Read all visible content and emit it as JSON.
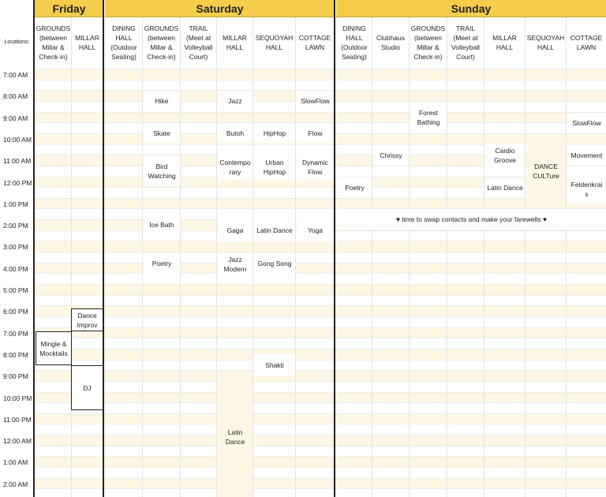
{
  "days": {
    "friday": "Friday",
    "saturday": "Saturday",
    "sunday": "Sunday"
  },
  "locations_label": "Locations:",
  "columns": {
    "fri_grounds": "GROUNDS (between Millar & Check-in)",
    "fri_millar": "MILLAR HALL",
    "sat_dining": "DINING HALL (Outdoor Seating)",
    "sat_grounds": "GROUNDS (between Millar & Check-in)",
    "sat_trail": "TRAIL (Meet at Volleyball Court)",
    "sat_millar": "MILLAR HALL",
    "sat_sequoyah": "SEQUOYAH HALL",
    "sat_cottage": "COTTAGE LAWN",
    "sun_dining": "DINING HALL (Outdoor Seating)",
    "sun_clubhaus": "Clubhaus Studio",
    "sun_grounds": "GROUNDS (between Millar & Check-in)",
    "sun_trail": "TRAIL (Meet at Volleyball Court)",
    "sun_millar": "MILLAR HALL",
    "sun_sequoyah": "SEQUOYAH HALL",
    "sun_cottage": "COTTAGE LAWN"
  },
  "times": [
    "7:00 AM",
    "8:00 AM",
    "9:00 AM",
    "10:00 AM",
    "11:00 AM",
    "12:00 PM",
    "1:00 PM",
    "2:00 PM",
    "3:00 PM",
    "4:00 PM",
    "5:00 PM",
    "6:00 PM",
    "7:00 PM",
    "8:00 PM",
    "9:00 PM",
    "10:00 PM",
    "11:00 PM",
    "12:00 AM",
    "1:00 AM",
    "2:00 AM"
  ],
  "events": {
    "hike": "Hike",
    "skate": "Skate",
    "bird_watching": "Bird Watching",
    "ice_bath": "Ice Bath",
    "sat_poetry": "Poetry",
    "jazz": "Jazz",
    "butoh": "Butoh",
    "contemporary": "Contempo rary",
    "gaga": "Gaga",
    "jazz_modern": "Jazz Modern",
    "latin_dance_sat_millar": "Latin Dance",
    "hiphop": "HipHop",
    "urban_hiphop": "Urban HipHop",
    "latin_dance_sequoyah": "Latin Dance",
    "gong_song": "Gong Song",
    "shakti": "Shakti",
    "slowflow_sat": "SlowFlow",
    "flow": "Flow",
    "dynamic_flow": "Dynamic Flow",
    "yoga": "Yoga",
    "dance_improv": "Dance Improv",
    "mingle": "Mingle & Mocktails",
    "dj": "DJ",
    "sun_poetry": "Poetry",
    "chrissy": "Chrissy",
    "forest_bathing": "Forest Bathing",
    "cardio_groove": "Cardio Groove",
    "latin_dance_sun": "Latin Dance",
    "dance_culture": "DANCE CULTure",
    "slowflow_sun": "SlowFlow",
    "movement": "Movement",
    "feldenkrais": "Feldenkrai s",
    "farewell": "♥ time to swap contacts and make your farewells ♥"
  },
  "colors": {
    "header": "#f6cd4b",
    "stripe": "#fdf7e3",
    "border": "#222222"
  }
}
